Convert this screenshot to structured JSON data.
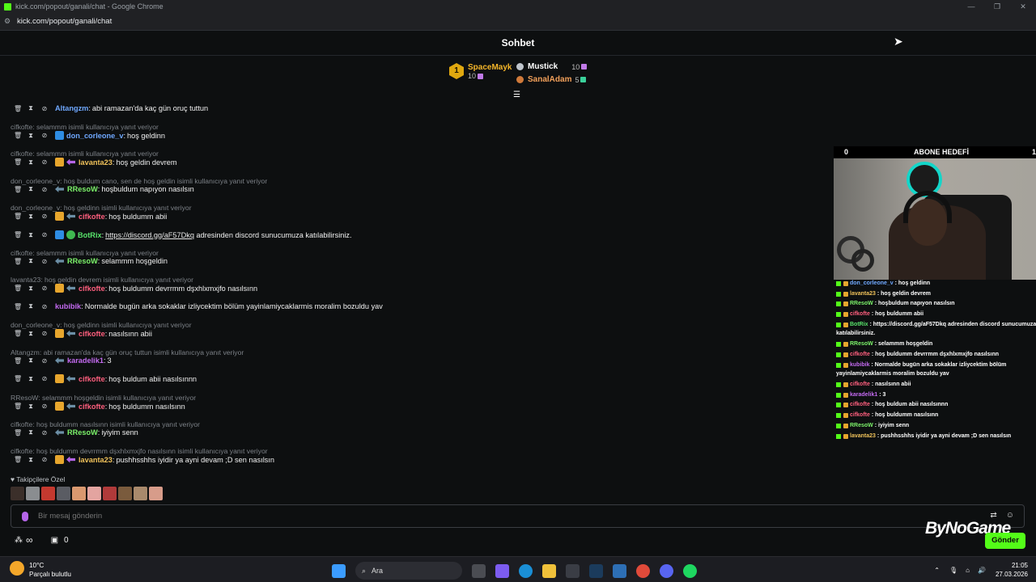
{
  "window": {
    "title": "kick.com/popout/ganali/chat - Google Chrome",
    "url": "kick.com/popout/ganali/chat"
  },
  "header": {
    "title": "Sohbet"
  },
  "leaderboard": {
    "first": {
      "rank": "1",
      "name": "SpaceMayk",
      "count": "10"
    },
    "second": {
      "name": "Mustick",
      "count": "10"
    },
    "third": {
      "name": "SanalAdam",
      "count": "5"
    }
  },
  "colors": {
    "kick_green": "#53fc18",
    "gold": "#f5b62a"
  },
  "messages": [
    {
      "reply": "",
      "user": "Altangzm",
      "color": "#6fa8ff",
      "text": "abi ramazan'da kaç gün oruç tuttun",
      "badges": []
    },
    {
      "reply": "cifkofte: selammm isimli kullanıcıya yanıt veriyor",
      "user": "don_corleone_v",
      "color": "#6fa8ff",
      "text": "hoş geldinn",
      "badges": [
        "blue"
      ]
    },
    {
      "reply": "cifkofte: selammm isimli kullanıcıya yanıt veriyor",
      "user": "lavanta23",
      "color": "#f0c25a",
      "text": "hoş geldin devrem",
      "badges": [
        "sub",
        "giftp"
      ]
    },
    {
      "reply": "don_corleone_v: hoş buldum cano, sen de hoş geldin isimli kullanıcıya yanıt veriyor",
      "user": "RResoW",
      "color": "#7cf26a",
      "text": "hoşbuldum napıyon nasılsın",
      "badges": [
        "gift"
      ]
    },
    {
      "reply": "don_corleone_v: hoş geldinn isimli kullanıcıya yanıt veriyor",
      "user": "cifkofte",
      "color": "#ff5f7e",
      "text": "hoş buldumm abii",
      "badges": [
        "sub",
        "gift"
      ]
    },
    {
      "reply": "",
      "user": "BotRix",
      "color": "#58e46b",
      "text": "",
      "link": "https://discord.gg/aF57Dkq",
      "after": " adresinden discord sunucumuza katılabilirsiniz.",
      "badges": [
        "blue",
        "verif"
      ]
    },
    {
      "reply": "cifkofte: selammm isimli kullanıcıya yanıt veriyor",
      "user": "RResoW",
      "color": "#7cf26a",
      "text": "selammm hoşgeldin",
      "badges": [
        "gift"
      ]
    },
    {
      "reply": "lavanta23: hoş geldin devrem isimli kullanıcıya yanıt veriyor",
      "user": "cifkofte",
      "color": "#ff5f7e",
      "text": "hoş buldumm devrrmm dşxhlxmxjfo nasılsınn",
      "badges": [
        "sub",
        "gift"
      ]
    },
    {
      "reply": "",
      "user": "kubibik",
      "color": "#c36af0",
      "text": "Normalde bugün arka sokaklar izliycektim bölüm yayinlamiycaklarmis moralim bozuldu yav",
      "badges": []
    },
    {
      "reply": "don_corleone_v: hoş geldinn isimli kullanıcıya yanıt veriyor",
      "user": "cifkofte",
      "color": "#ff5f7e",
      "text": "nasılsınn abii",
      "badges": [
        "sub",
        "gift"
      ]
    },
    {
      "reply": "Altangzm: abi ramazan'da kaç gün oruç tuttun isimli kullanıcıya yanıt veriyor",
      "user": "karadelik1",
      "color": "#c36af0",
      "text": "3",
      "badges": [
        "gift"
      ]
    },
    {
      "reply": "",
      "user": "cifkofte",
      "color": "#ff5f7e",
      "text": "hoş buldum abii nasılsınnn",
      "badges": [
        "sub",
        "gift"
      ]
    },
    {
      "reply": "RResoW: selammm hoşgeldin isimli kullanıcıya yanıt veriyor",
      "user": "cifkofte",
      "color": "#ff5f7e",
      "text": "hoş buldumm nasılsınn",
      "badges": [
        "sub",
        "gift"
      ]
    },
    {
      "reply": "cifkofte: hoş buldumm nasılsınn isimli kullanıcıya yanıt veriyor",
      "user": "RResoW",
      "color": "#7cf26a",
      "text": "iyiyim senn",
      "badges": [
        "gift"
      ]
    },
    {
      "reply": "cifkofte: hoş buldumm devrrmm dşxhlxmxjfo nasılsınn isimli kullanıcıya yanıt veriyor",
      "user": "lavanta23",
      "color": "#f0c25a",
      "text": "pushhsshhs iyidir ya ayni devam ;D sen nasılsın",
      "badges": [
        "sub",
        "giftp"
      ]
    }
  ],
  "followers_label": "Takipçilere Özel",
  "input": {
    "placeholder": "Bir mesaj gönderin"
  },
  "bottom": {
    "infinity": "∞",
    "count": "0",
    "send": "Gönder"
  },
  "overlay": {
    "goal_left": "0",
    "goal_title": "ABONE HEDEFİ",
    "goal_right": "1",
    "watermark": "ByNoGame",
    "mini_chat": [
      {
        "user": "don_corleone_v",
        "text": " : hoş geldinn",
        "color": "#6fa8ff"
      },
      {
        "user": "lavanta23",
        "text": " : hoş geldin devrem",
        "color": "#f0c25a"
      },
      {
        "user": "RResoW",
        "text": " : hoşbuldum napıyon nasılsın",
        "color": "#7cf26a"
      },
      {
        "user": "cifkofte",
        "text": " : hoş buldumm abii",
        "color": "#ff5f7e"
      },
      {
        "user": "BotRix",
        "text": " : https://discord.gg/aF57Dkq adresinden discord sunucumuza",
        "color": "#58e46b"
      },
      {
        "user": "",
        "text": "katılabilirsiniz.",
        "color": "#fff"
      },
      {
        "user": "RResoW",
        "text": " : selammm hoşgeldin",
        "color": "#7cf26a"
      },
      {
        "user": "cifkofte",
        "text": " : hoş buldumm devrrmm dşxhlxmxjfo nasılsınn",
        "color": "#ff5f7e"
      },
      {
        "user": "kubibik",
        "text": " : Normalde bugün arka sokaklar izliycektim bölüm",
        "color": "#c36af0"
      },
      {
        "user": "",
        "text": "yayinlamiycaklarmis moralim bozuldu yav",
        "color": "#fff"
      },
      {
        "user": "cifkofte",
        "text": " : nasılsınn abii",
        "color": "#ff5f7e"
      },
      {
        "user": "karadelik1",
        "text": " : 3",
        "color": "#c36af0"
      },
      {
        "user": "cifkofte",
        "text": " : hoş buldum abii nasılsınnn",
        "color": "#ff5f7e"
      },
      {
        "user": "cifkofte",
        "text": " : hoş buldumm nasılsınn",
        "color": "#ff5f7e"
      },
      {
        "user": "RResoW",
        "text": " : iyiyim senn",
        "color": "#7cf26a"
      },
      {
        "user": "lavanta23",
        "text": " : pushhsshhs iyidir ya ayni devam ;D sen nasılsın",
        "color": "#f0c25a"
      }
    ]
  },
  "taskbar": {
    "temp": "10°C",
    "weather": "Parçalı bulutlu",
    "search": "Ara",
    "time": "21:05",
    "date": "27.03.2026"
  }
}
